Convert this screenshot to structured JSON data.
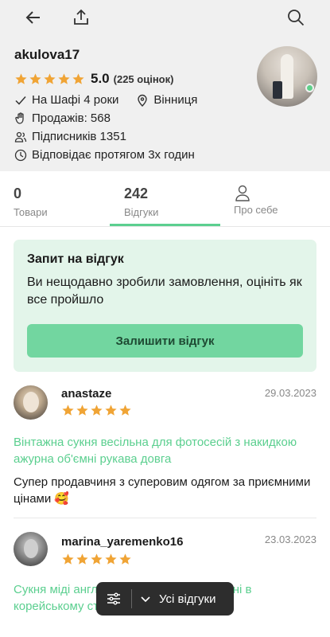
{
  "topbar": {
    "back_icon": "back-arrow-icon",
    "share_icon": "share-icon",
    "search_icon": "search-icon"
  },
  "profile": {
    "username": "akulova17",
    "rating": "5.0",
    "rating_count": "(225 оцінок)",
    "on_shafa": "На Шафі 4 роки",
    "city": "Вінниця",
    "sales": "Продажів: 568",
    "followers": "Підписників 1351",
    "response": "Відповідає протягом 3х годин",
    "online_color": "#5fd08a"
  },
  "tabs": [
    {
      "num": "0",
      "label": "Товари"
    },
    {
      "num": "242",
      "label": "Відгуки"
    },
    {
      "num": "",
      "label": "Про себе"
    }
  ],
  "request": {
    "title": "Запит на відгук",
    "text": "Ви нещодавно зробили замовлення, оцініть як все пройшло",
    "button": "Залишити відгук"
  },
  "reviews": [
    {
      "name": "anastaze",
      "date": "29.03.2023",
      "stars": 5,
      "item": "Вінтажна сукня весільна для фотосесій з накидкою ажурна об'ємні рукава довга",
      "text": "Супер продавчиня з суперовим одягом за приємними цінами 🥰"
    },
    {
      "name": "marina_yaremenko16",
      "date": "23.03.2023",
      "stars": 5,
      "item": "Сукня міді англійська вінтаж міді вінтажні в корейському стилі",
      "text": ""
    }
  ],
  "filter": {
    "label": "Усі відгуки"
  },
  "colors": {
    "accent": "#5bcf8f",
    "star": "#f0a435",
    "request_bg": "#e3f5ea",
    "button_bg": "#72d6a0"
  }
}
